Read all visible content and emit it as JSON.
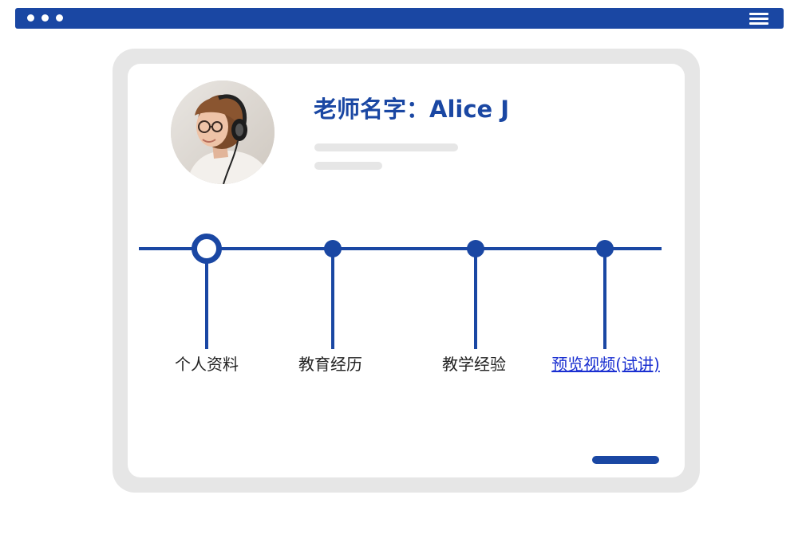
{
  "browser": {
    "window_dots": [
      "dot",
      "dot",
      "dot"
    ],
    "menu_icon": "hamburger-menu-icon",
    "accent_color": "#1a47a3"
  },
  "profile": {
    "teacher_name": "老师名字：Alice J",
    "avatar_icon": "teacher-photo-with-headphones"
  },
  "timeline": {
    "items": [
      {
        "label": "个人资料",
        "active": true
      },
      {
        "label": "教育经历",
        "active": false
      },
      {
        "label": "教学经验",
        "active": false
      },
      {
        "label": "预览视频(试讲)",
        "active": false,
        "link": true
      }
    ]
  },
  "colors": {
    "brand": "#1a47a3",
    "frame": "#e6e6e6",
    "link": "#1a2fd1"
  }
}
